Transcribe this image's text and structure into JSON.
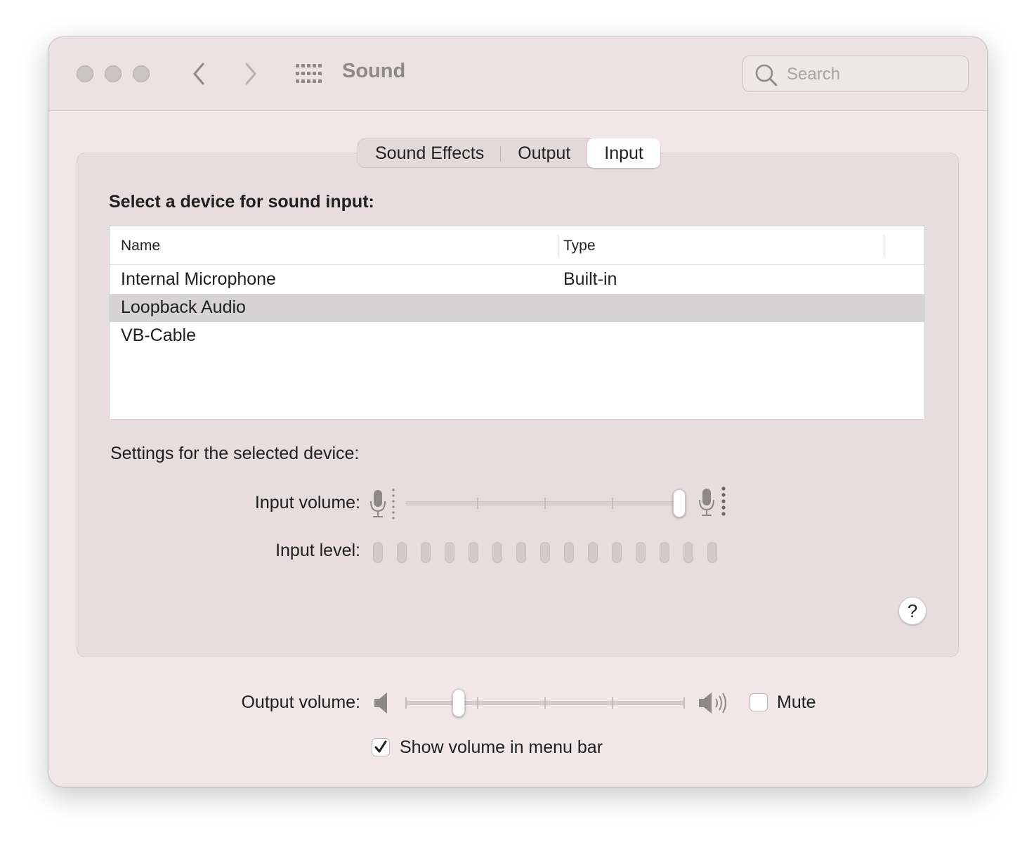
{
  "window": {
    "title": "Sound",
    "search_placeholder": "Search"
  },
  "tabs": [
    {
      "label": "Sound Effects",
      "active": false
    },
    {
      "label": "Output",
      "active": false
    },
    {
      "label": "Input",
      "active": true
    }
  ],
  "input": {
    "heading": "Select a device for sound input:",
    "columns": {
      "name": "Name",
      "type": "Type"
    },
    "devices": [
      {
        "name": "Internal Microphone",
        "type": "Built-in",
        "selected": false
      },
      {
        "name": "Loopback Audio",
        "type": "",
        "selected": true
      },
      {
        "name": "VB-Cable",
        "type": "",
        "selected": false
      }
    ],
    "settings_heading": "Settings for the selected device:",
    "input_volume_label": "Input volume:",
    "input_volume_value": 1.0,
    "input_level_label": "Input level:",
    "input_level_segments": 15,
    "input_level_value": 0
  },
  "help_label": "?",
  "output": {
    "volume_label": "Output volume:",
    "volume_value": 0.19,
    "mute_label": "Mute",
    "mute_checked": false,
    "show_in_menu_bar_label": "Show volume in menu bar",
    "show_in_menu_bar_checked": true
  },
  "icons": {
    "close": "close-dot",
    "minimize": "minimize-dot",
    "zoom": "zoom-dot",
    "back": "chevron-left-icon",
    "forward": "chevron-right-icon",
    "show_all": "grid-icon",
    "search": "search-icon",
    "mic_low": "mic-low-icon",
    "mic_high": "mic-high-icon",
    "speaker_low": "speaker-low-icon",
    "speaker_high": "speaker-high-icon",
    "check": "checkmark-icon"
  }
}
